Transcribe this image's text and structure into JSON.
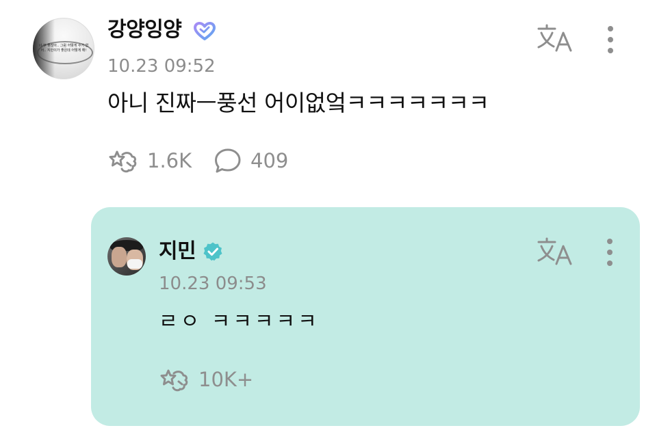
{
  "post": {
    "username": "강양잉양",
    "avatar_caption": "너-무 좋잖아.. 그럼 어떻게 수가 없어.. 지민이가 좋은데 어떻게 해!",
    "timestamp": "10.23 09:52",
    "text": "아니 진짜ㅡ풍선 어이없엌ㅋㅋㅋㅋㅋㅋㅋ",
    "like_count": "1.6K",
    "comment_count": "409",
    "badge_icon": "heart-badge-icon",
    "badge_color": "#7b8cf5"
  },
  "reply": {
    "username": "지민",
    "timestamp": "10.23 09:53",
    "text": "ㄹㅇ ㅋㅋㅋㅋㅋ",
    "like_count": "10K+",
    "badge_icon": "verified-check-icon",
    "badge_color": "#4ec3c9",
    "card_color": "#c2ebe4"
  },
  "icons": {
    "translate": "translate-icon",
    "more": "more-vertical-icon",
    "like": "star-hand-like-icon",
    "comment": "speech-bubble-icon"
  },
  "colors": {
    "text": "#111111",
    "muted": "#8c8c8c",
    "icon": "#8e8e8e"
  }
}
